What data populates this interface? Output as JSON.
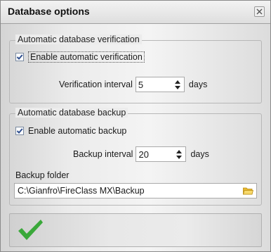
{
  "window": {
    "title": "Database options",
    "close_icon": "close-icon"
  },
  "verification": {
    "legend": "Automatic database verification",
    "checkbox_label": "Enable automatic verification",
    "checked": true,
    "interval_label": "Verification interval",
    "interval_value": "5",
    "interval_unit": "days"
  },
  "backup": {
    "legend": "Automatic database backup",
    "checkbox_label": "Enable automatic backup",
    "checked": true,
    "interval_label": "Backup interval",
    "interval_value": "20",
    "interval_unit": "days",
    "folder_label": "Backup folder",
    "folder_path": "C:\\Gianfro\\FireClass MX\\Backup",
    "folder_icon": "folder-icon"
  },
  "actions": {
    "ok_icon": "checkmark-icon"
  },
  "colors": {
    "check_green": "#3aa83a",
    "folder_yellow": "#f2c94c",
    "checkbox_tick": "#2f4f8f"
  }
}
